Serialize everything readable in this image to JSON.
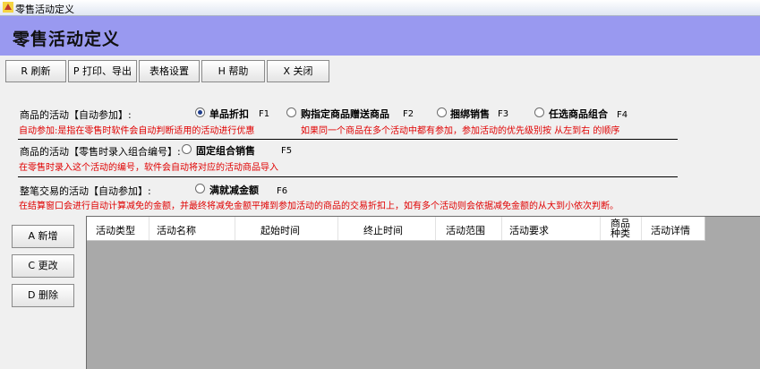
{
  "window": {
    "title": "零售活动定义"
  },
  "header": {
    "title": "零售活动定义"
  },
  "toolbar": [
    {
      "label": "R 刷新"
    },
    {
      "label": "P 打印、导出"
    },
    {
      "label": "表格设置"
    },
    {
      "label": "H 帮助"
    },
    {
      "label": "X 关闭"
    }
  ],
  "section1": {
    "label": "商品的活动【自动参加】:",
    "options": [
      {
        "label": "单品折扣",
        "key": "F1",
        "selected": true
      },
      {
        "label": "购指定商品赠送商品",
        "key": "F2",
        "selected": false
      },
      {
        "label": "捆绑销售",
        "key": "F3",
        "selected": false
      },
      {
        "label": "任选商品组合",
        "key": "F4",
        "selected": false
      }
    ],
    "note_left": "自动参加:是指在零售时软件会自动判断适用的活动进行优惠",
    "note_right": "如果同一个商品在多个活动中都有参加，参加活动的优先级别按 从左到右 的顺序"
  },
  "section2": {
    "label": "商品的活动【零售时录入组合编号】:",
    "option": {
      "label": "固定组合销售",
      "key": "F5",
      "selected": false
    },
    "note": "在零售时录入这个活动的编号，软件会自动将对应的活动商品导入"
  },
  "section3": {
    "label": "整笔交易的活动【自动参加】:",
    "option": {
      "label": "满就减金额",
      "key": "F6",
      "selected": false
    },
    "note": "在结算窗口会进行自动计算减免的金额，并最终将减免金额平摊到参加活动的商品的交易折扣上，如有多个活动则会依据减免金额的从大到小依次判断。"
  },
  "side_buttons": [
    {
      "label": "A 新增"
    },
    {
      "label": "C 更改"
    },
    {
      "label": "D 删除"
    }
  ],
  "table": {
    "columns": [
      "活动类型",
      "活动名称",
      "起始时间",
      "终止时间",
      "活动范围",
      "活动要求",
      "商品种类",
      "活动详情"
    ],
    "rows": []
  },
  "colors": {
    "banner": "#9999f0",
    "note_text": "#e00000",
    "grid_background": "#a9a9a9"
  }
}
